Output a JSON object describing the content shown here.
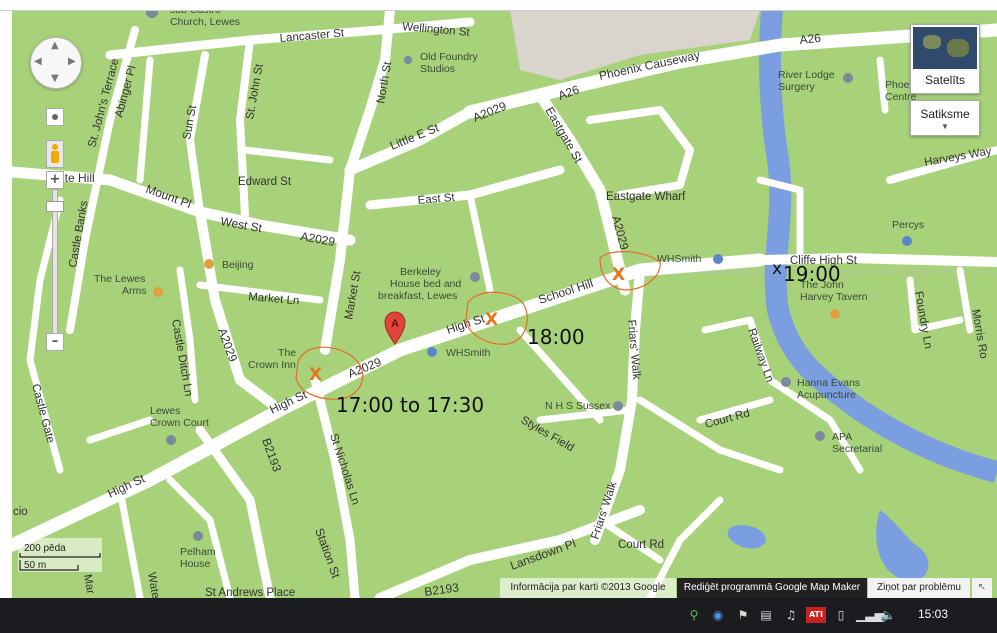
{
  "map": {
    "roads": {
      "a26_phoenix": "A26",
      "phoenix_causeway": "Phoenix Causeway",
      "a26_east": "A26",
      "lancaster_st": "Lancaster St",
      "wellington_st": "Wellington St",
      "north_st": "North St",
      "little_e_st": "Little E St",
      "a2029_north": "A2029",
      "eastgate_st": "Eastgate St",
      "sun_st": "Sun St",
      "st_johns_st": "St. John St",
      "st_johns_terrace": "St. John's Terrace",
      "abinger_pl": "Abinger Pl",
      "white_hill": "ite Hill",
      "mount_pl": "Mount Pl",
      "west_st": "West St",
      "a2029_west": "A2029",
      "edward_st": "Edward St",
      "east_st": "East St",
      "eastgate_wharf": "Eastgate Wharf",
      "a2029_eastgate": "A2029",
      "castle_banks": "Castle Banks",
      "market_st": "Market St",
      "market_ln": "Market Ln",
      "high_st_mid": "High St",
      "school_hill": "School Hill",
      "a2029_high": "A2029",
      "high_st_west": "High St",
      "high_st_far": "High St",
      "castle_ditch_ln": "Castle Ditch Ln",
      "castle_gate": "Castle Gate",
      "a2029_sw": "A2029",
      "b2193_a": "B2193",
      "station_st": "Station St",
      "st_nicholas_ln": "St Nicholas Ln",
      "friars_walk": "Friars' Walk",
      "friars_walk_s": "Friars' Walk",
      "styles_field": "Styles Field",
      "lansdown_pl": "Lansdown Pl",
      "court_rd": "Court Rd",
      "court_rd_e": "Court Rd",
      "railway_ln": "Railway Ln",
      "cliffe_high_st": "Cliffe High St",
      "harveys_way": "Harveys Way",
      "foundry_ln": "Foundry Ln",
      "morris_rd": "Morris Ro",
      "b2193_b": "B2193",
      "st_andrews_place": "St Andrews Place",
      "marts": "Mar",
      "watergate": "Wate",
      "cio": "cio"
    },
    "pois": {
      "castro_church": "sub Castro\nChurch, Lewes",
      "old_foundry": "Old Foundry\nStudios",
      "river_lodge": "River Lodge\nSurgery",
      "phoenix_centre": "Phoe\nCentre",
      "percys": "Percys",
      "whsmith_ne": "WHSmith",
      "john_harvey": "The John\nHarvey Tavern",
      "berkeley_house": "Berkeley\nHouse bed and\nbreakfast, Lewes",
      "beijing": "Beijing",
      "lewes_arms": "The Lewes\nArms",
      "crown_inn": "The\nCrown Inn",
      "whsmith_high": "WHSmith",
      "nhs_sussex": "N H S Sussex",
      "hanna_evans": "Hanna Evans\nAcupuncture",
      "apa": "APA\nSecretarial",
      "lewes_crown_court": "Lewes\nCrown Court",
      "pelham_house": "Pelham\nHouse"
    },
    "marker_label": "A",
    "annotations": {
      "t1": "17:00 to 17:30",
      "t2": "18:00",
      "t3": "19:00",
      "x1": "X",
      "x2": "X",
      "x3": "X",
      "x4": "x"
    },
    "colors": {
      "land": "#a8d27a",
      "road": "#ffffff",
      "river": "#7a9ee0",
      "grey_area": "#d9d4cc",
      "annotation_x": "#e8741e",
      "annotation_circle": "#ea6a2a"
    }
  },
  "controls": {
    "zoom_in": "+",
    "zoom_out": "–",
    "satellite": "Satelīts",
    "traffic": "Satiksme",
    "scale_ft": "200 pēda",
    "scale_m": "50 m"
  },
  "footer": {
    "map_info": "Informācija par karti ©2013 Google",
    "map_maker": "Rediģēt programmā Google Map Maker",
    "report": "Ziņot par problēmu"
  },
  "taskbar": {
    "clock": "15:03",
    "ati": "ATI"
  }
}
